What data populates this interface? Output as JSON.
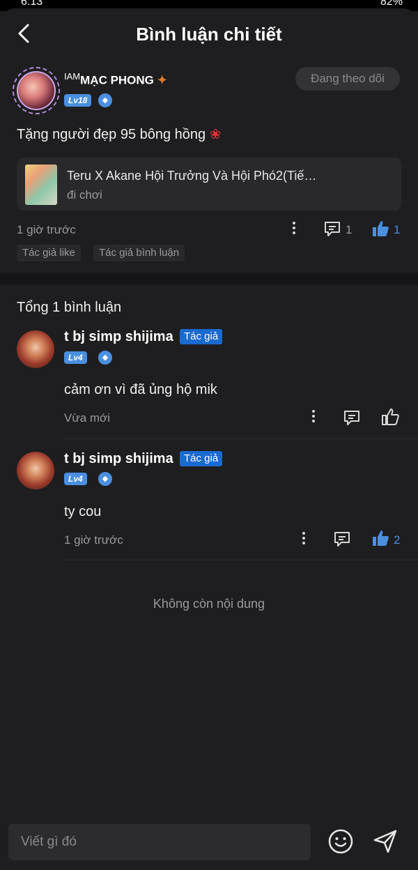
{
  "status_bar": {
    "time": "6:13",
    "battery": "82%"
  },
  "header": {
    "title": "Bình luận chi tiết"
  },
  "post": {
    "author_prefix": "IAM",
    "author_name": "MẠC PHONG",
    "level": "Lv18",
    "follow_label": "Đang theo dõi",
    "text": "Tặng người đẹp 95 bông hồng",
    "linked": {
      "title": "Teru X Akane Hội Trưởng Và Hội Phó2(Tiế…",
      "subtitle": "đi chơi"
    },
    "time": "1 giờ trước",
    "comment_count": "1",
    "like_count": "1",
    "tags": [
      "Tác giả like",
      "Tác giả bình luận"
    ]
  },
  "comments_section": {
    "total": "Tổng 1 bình luận",
    "comments": [
      {
        "name": "t bj simp shijima",
        "badge": "Tác giả",
        "level": "Lv4",
        "text": "cảm ơn vì đã ủng hộ mik",
        "time": "Vừa mới",
        "like_count": ""
      },
      {
        "name": "t bj simp shijima",
        "badge": "Tác giả",
        "level": "Lv4",
        "text": "ty cou",
        "time": "1 giờ trước",
        "like_count": "2"
      }
    ],
    "end_text": "Không còn nội dung"
  },
  "composer": {
    "placeholder": "Viết gì đó"
  },
  "colors": {
    "accent": "#4a8fe0",
    "author_badge": "#1a6ad0",
    "background": "#1e1e20"
  },
  "icons": [
    "back-icon",
    "leaf-icon",
    "shield-icon",
    "more-icon",
    "comment-icon",
    "like-icon",
    "emoji-icon",
    "send-icon"
  ]
}
